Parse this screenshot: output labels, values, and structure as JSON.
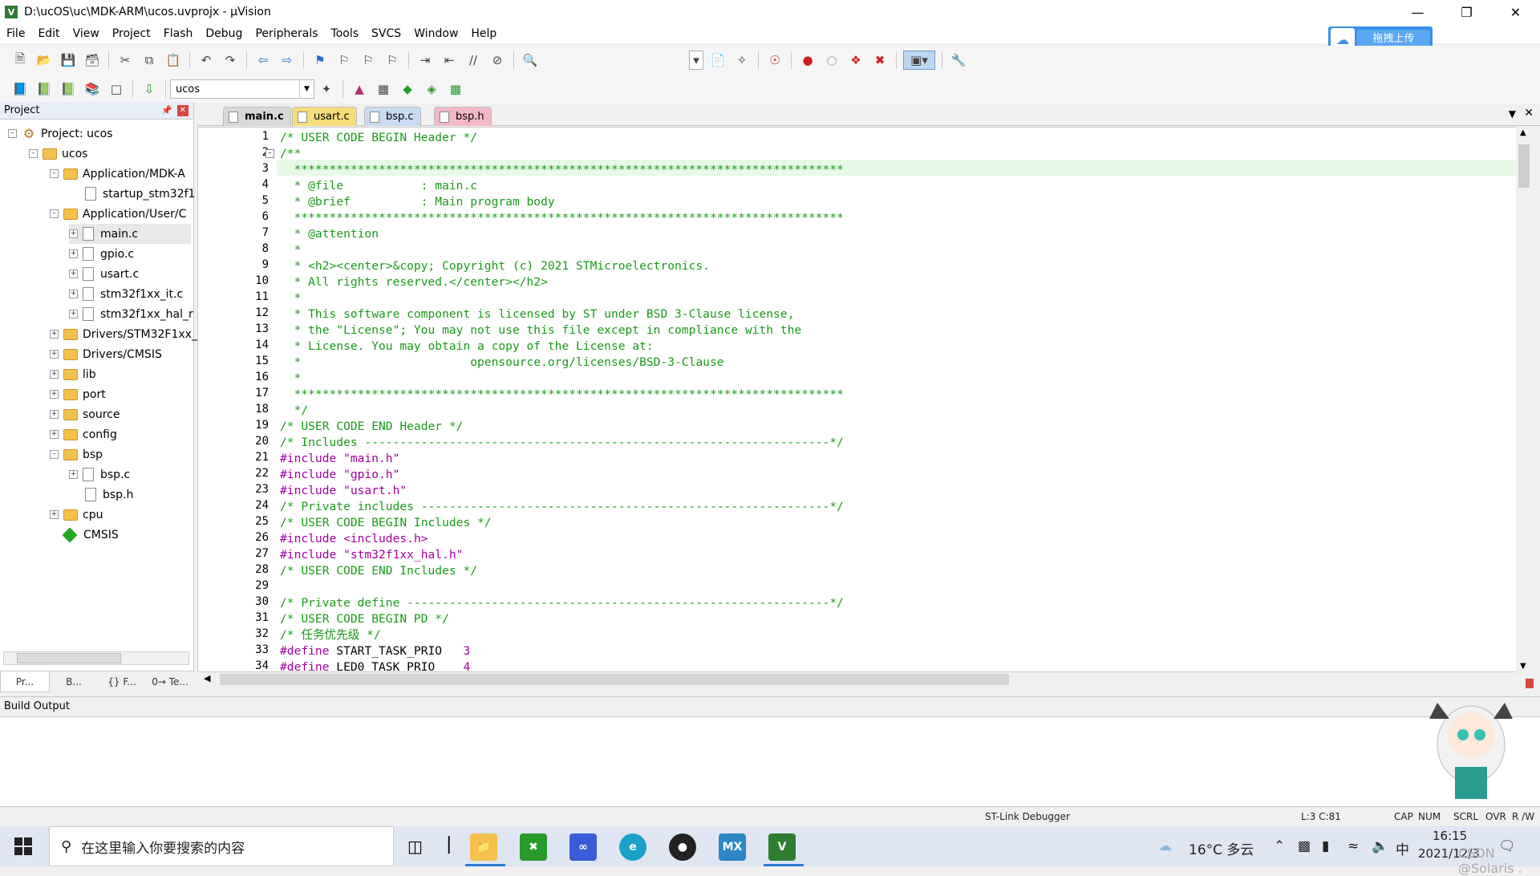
{
  "window": {
    "title": "D:\\ucOS\\uc\\MDK-ARM\\ucos.uvprojx - µVision",
    "app_icon": "V"
  },
  "menu": [
    "File",
    "Edit",
    "View",
    "Project",
    "Flash",
    "Debug",
    "Peripherals",
    "Tools",
    "SVCS",
    "Window",
    "Help"
  ],
  "cloud_button": {
    "label": "拖拽上传"
  },
  "toolbar2": {
    "target_name": "ucos"
  },
  "project_panel": {
    "title": "Project",
    "tree": [
      {
        "label": "Project: ucos"
      },
      {
        "label": "ucos"
      },
      {
        "label": "Application/MDK-A"
      },
      {
        "label": "startup_stm32f1"
      },
      {
        "label": "Application/User/C"
      },
      {
        "label": "main.c"
      },
      {
        "label": "gpio.c"
      },
      {
        "label": "usart.c"
      },
      {
        "label": "stm32f1xx_it.c"
      },
      {
        "label": "stm32f1xx_hal_r"
      },
      {
        "label": "Drivers/STM32F1xx_"
      },
      {
        "label": "Drivers/CMSIS"
      },
      {
        "label": "lib"
      },
      {
        "label": "port"
      },
      {
        "label": "source"
      },
      {
        "label": "config"
      },
      {
        "label": "bsp"
      },
      {
        "label": "bsp.c"
      },
      {
        "label": "bsp.h"
      },
      {
        "label": "cpu"
      },
      {
        "label": "CMSIS"
      }
    ],
    "bottom_tabs": [
      "Pr...",
      "B...",
      "{} F...",
      "0→ Te..."
    ]
  },
  "editor": {
    "tabs": [
      {
        "label": "main.c",
        "color": "#d8d8d8"
      },
      {
        "label": "usart.c",
        "color": "#f7dc7a"
      },
      {
        "label": "bsp.c",
        "color": "#c7dcf0"
      },
      {
        "label": "bsp.h",
        "color": "#f3b8c6"
      }
    ],
    "lines": [
      {
        "n": "1",
        "t": "/* USER CODE BEGIN Header */",
        "k": "com"
      },
      {
        "n": "2",
        "t": "/**",
        "k": "com"
      },
      {
        "n": "3",
        "t": "  ******************************************************************************",
        "k": "com"
      },
      {
        "n": "4",
        "t": "  * @file           : main.c",
        "k": "com"
      },
      {
        "n": "5",
        "t": "  * @brief          : Main program body",
        "k": "com"
      },
      {
        "n": "6",
        "t": "  ******************************************************************************",
        "k": "com"
      },
      {
        "n": "7",
        "t": "  * @attention",
        "k": "com"
      },
      {
        "n": "8",
        "t": "  *",
        "k": "com"
      },
      {
        "n": "9",
        "t": "  * <h2><center>&copy; Copyright (c) 2021 STMicroelectronics.",
        "k": "com"
      },
      {
        "n": "10",
        "t": "  * All rights reserved.</center></h2>",
        "k": "com"
      },
      {
        "n": "11",
        "t": "  *",
        "k": "com"
      },
      {
        "n": "12",
        "t": "  * This software component is licensed by ST under BSD 3-Clause license,",
        "k": "com"
      },
      {
        "n": "13",
        "t": "  * the \"License\"; You may not use this file except in compliance with the",
        "k": "com"
      },
      {
        "n": "14",
        "t": "  * License. You may obtain a copy of the License at:",
        "k": "com"
      },
      {
        "n": "15",
        "t": "  *                        opensource.org/licenses/BSD-3-Clause",
        "k": "com"
      },
      {
        "n": "16",
        "t": "  *",
        "k": "com"
      },
      {
        "n": "17",
        "t": "  ******************************************************************************",
        "k": "com"
      },
      {
        "n": "18",
        "t": "  */",
        "k": "com"
      },
      {
        "n": "19",
        "t": "/* USER CODE END Header */",
        "k": "com"
      },
      {
        "n": "20",
        "t": "/* Includes ------------------------------------------------------------------*/",
        "k": "com"
      },
      {
        "n": "21",
        "pp": "#include ",
        "s": "\"main.h\"",
        "k": "inc"
      },
      {
        "n": "22",
        "pp": "#include ",
        "s": "\"gpio.h\"",
        "k": "inc"
      },
      {
        "n": "23",
        "pp": "#include ",
        "s": "\"usart.h\"",
        "k": "inc"
      },
      {
        "n": "24",
        "t": "/* Private includes ----------------------------------------------------------*/",
        "k": "com"
      },
      {
        "n": "25",
        "t": "/* USER CODE BEGIN Includes */",
        "k": "com"
      },
      {
        "n": "26",
        "pp": "#include ",
        "s": "<includes.h>",
        "k": "inc"
      },
      {
        "n": "27",
        "pp": "#include ",
        "s": "\"stm32f1xx_hal.h\"",
        "k": "inc"
      },
      {
        "n": "28",
        "t": "/* USER CODE END Includes */",
        "k": "com"
      },
      {
        "n": "29",
        "t": "",
        "k": "com"
      },
      {
        "n": "30",
        "t": "/* Private define ------------------------------------------------------------*/",
        "k": "com"
      },
      {
        "n": "31",
        "t": "/* USER CODE BEGIN PD */",
        "k": "com"
      },
      {
        "n": "32",
        "t": "/* 任务优先级 */",
        "k": "com"
      },
      {
        "n": "33",
        "pp": "#define ",
        "s": "START_TASK_PRIO   ",
        "v": "3",
        "k": "def"
      },
      {
        "n": "34",
        "pp": "#define ",
        "s": "LED0_TASK_PRIO    ",
        "v": "4",
        "k": "def"
      }
    ]
  },
  "build_output": {
    "title": "Build Output"
  },
  "status": {
    "debugger": "ST-Link Debugger",
    "position": "L:3 C:81",
    "flags": [
      "CAP",
      "NUM",
      "SCRL",
      "OVR",
      "R /W"
    ]
  },
  "taskbar": {
    "search_placeholder": "在这里输入你要搜索的内容",
    "weather": "16°C 多云",
    "ime": "中",
    "time": "16:15",
    "date": "2021/12/3",
    "watermark": "CSDN @Solaris ."
  }
}
